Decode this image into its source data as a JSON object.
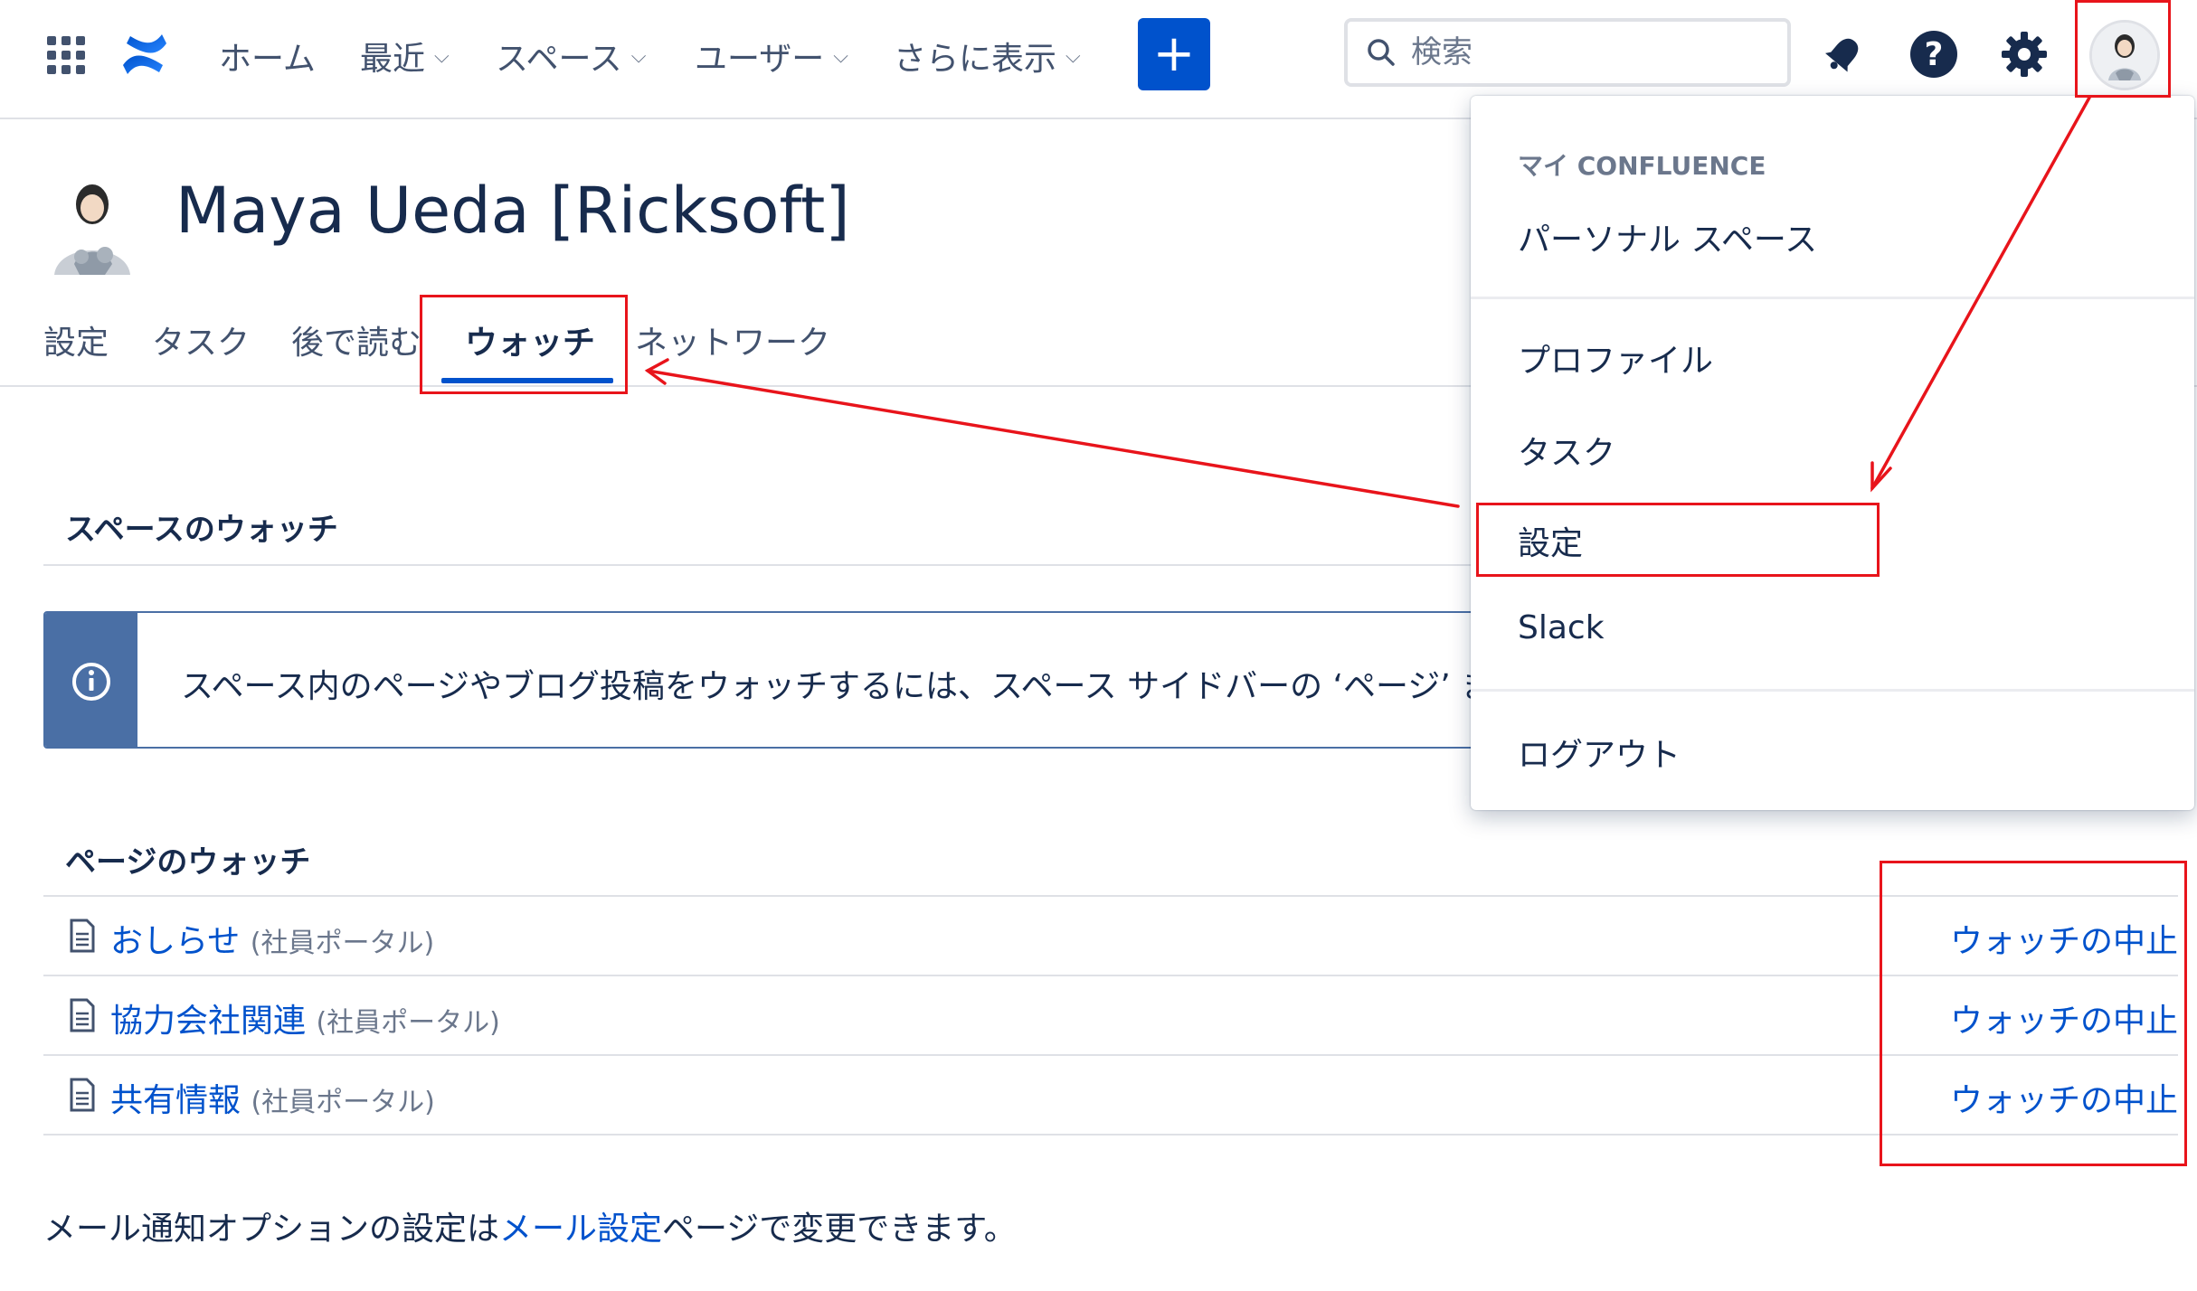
{
  "nav": {
    "items": [
      {
        "label": "ホーム",
        "has_chevron": false
      },
      {
        "label": "最近",
        "has_chevron": true
      },
      {
        "label": "スペース",
        "has_chevron": true
      },
      {
        "label": "ユーザー",
        "has_chevron": true
      },
      {
        "label": "さらに表示",
        "has_chevron": true
      }
    ],
    "create_label": "+",
    "search_placeholder": "検索",
    "icons": [
      "app-switcher-icon",
      "confluence-logo-icon",
      "search-icon",
      "notification-icon",
      "help-icon",
      "settings-icon"
    ]
  },
  "profile": {
    "name": "Maya Ueda [Ricksoft]",
    "tabs": [
      {
        "label": "設定",
        "active": false
      },
      {
        "label": "タスク",
        "active": false
      },
      {
        "label": "後で読む",
        "active": false
      },
      {
        "label": "ウォッチ",
        "active": true
      },
      {
        "label": "ネットワーク",
        "active": false
      }
    ]
  },
  "spaces_watch": {
    "title": "スペースのウォッチ",
    "info_text": "スペース内のページやブログ投稿をウォッチするには、スペース サイドバーの ‘ページ’ また"
  },
  "pages_watch": {
    "title": "ページのウォッチ",
    "rows": [
      {
        "title": "おしらせ",
        "space": "(社員ポータル)",
        "action": "ウォッチの中止"
      },
      {
        "title": "協力会社関連",
        "space": "(社員ポータル)",
        "action": "ウォッチの中止"
      },
      {
        "title": "共有情報",
        "space": "(社員ポータル)",
        "action": "ウォッチの中止"
      }
    ]
  },
  "footer": {
    "prefix": "メール通知オプションの設定は",
    "link": "メール設定",
    "suffix": "ページで変更できます。"
  },
  "dropdown": {
    "heading": "マイ CONFLUENCE",
    "items": [
      "パーソナル スペース",
      "プロファイル",
      "タスク",
      "設定",
      "Slack",
      "ログアウト"
    ]
  },
  "colors": {
    "primary": "#0052cc",
    "annotation_red": "#e8141b",
    "info_blue": "#4a6fa5"
  }
}
